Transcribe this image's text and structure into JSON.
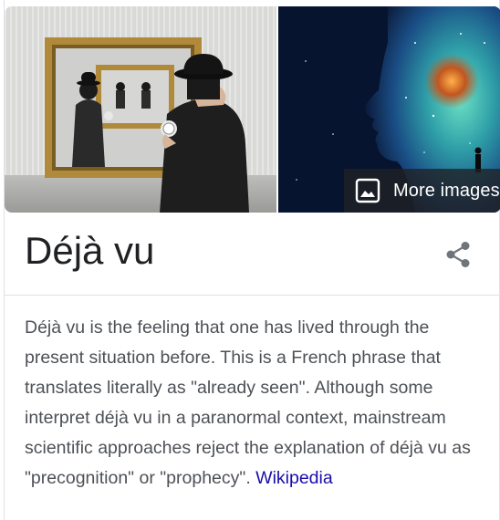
{
  "images": {
    "left": {
      "subject": "bowler-hat-man-mirror-painting"
    },
    "right": {
      "subject": "cosmic-face-silhouette"
    },
    "more_images_label": "More images"
  },
  "entity": {
    "title": "Déjà vu",
    "share_icon": "share-icon"
  },
  "description": {
    "text": "Déjà vu is the feeling that one has lived through the present situation before. This is a French phrase that translates literally as \"already seen\". Although some interpret déjà vu in a paranormal context, mainstream scientific approaches reject the explanation of déjà vu as \"precognition\" or \"prophecy\". ",
    "source_link": "Wikipedia"
  },
  "colors": {
    "title": "#202124",
    "body_text": "#4d5156",
    "link": "#1a0dab",
    "divider": "#dfe1e5",
    "icon_gray": "#70757a"
  }
}
